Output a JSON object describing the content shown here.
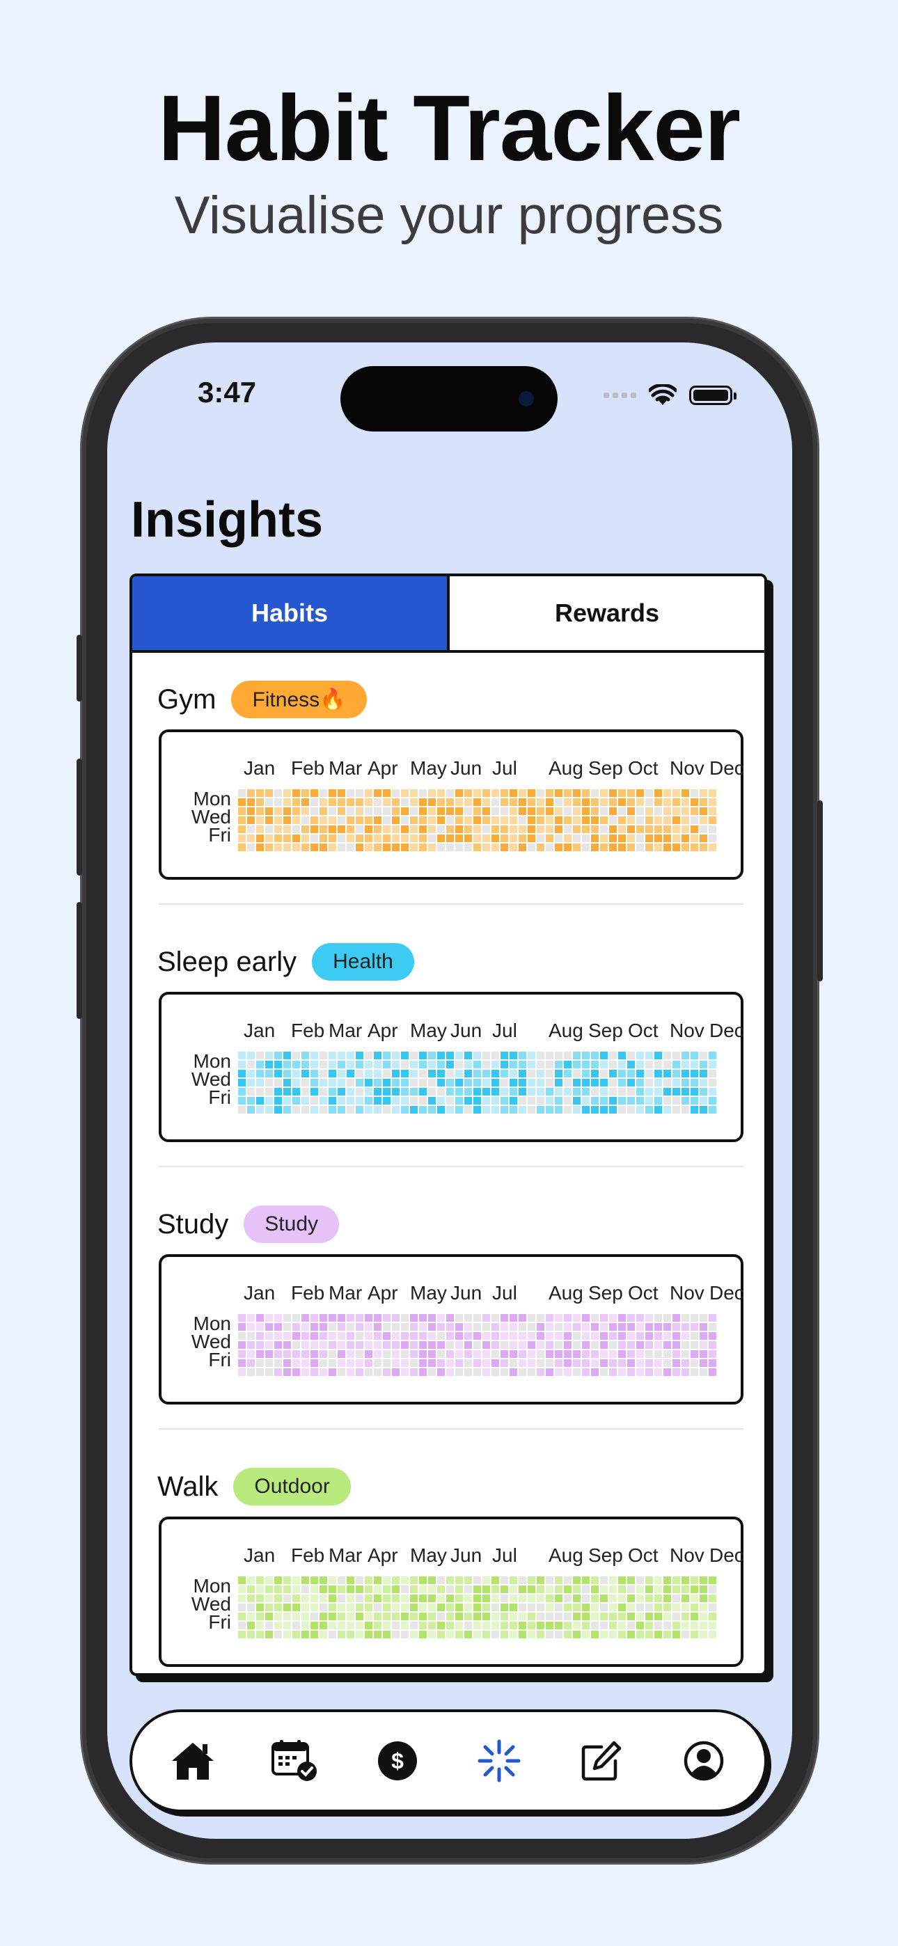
{
  "promo": {
    "title": "Habit Tracker",
    "subtitle": "Visualise your progress"
  },
  "status_bar": {
    "time": "3:47"
  },
  "page_title": "Insights",
  "tabs": [
    {
      "label": "Habits",
      "active": true
    },
    {
      "label": "Rewards",
      "active": false
    }
  ],
  "heatmap_labels": {
    "months": [
      "Jan",
      "Feb",
      "Mar",
      "Apr",
      "May",
      "Jun",
      "Jul",
      "Aug",
      "Sep",
      "Oct",
      "Nov",
      "Dec"
    ],
    "days": [
      "Mon",
      "Wed",
      "Fri"
    ]
  },
  "habits": [
    {
      "name": "Gym",
      "tag": "Fitness🔥",
      "tag_color": "#FFA833",
      "colors": [
        "#E6E6E6",
        "#FCD9A1",
        "#FBC66F",
        "#F9AB3A"
      ]
    },
    {
      "name": "Sleep early",
      "tag": "Health",
      "tag_color": "#3DCBF4",
      "colors": [
        "#E6E6E6",
        "#BFEBFA",
        "#86DDF6",
        "#35C7F2"
      ]
    },
    {
      "name": "Study",
      "tag": "Study",
      "tag_color": "#E7C2F8",
      "colors": [
        "#E6E6E6",
        "#F2DCFA",
        "#E9C7F8",
        "#DDA9F4"
      ]
    },
    {
      "name": "Walk",
      "tag": "Outdoor",
      "tag_color": "#B9EA7E",
      "colors": [
        "#E6E6E6",
        "#E3F6C9",
        "#CDEF9E",
        "#B3E46A"
      ]
    }
  ],
  "bottom_nav": [
    {
      "icon": "home-icon",
      "active": false
    },
    {
      "icon": "calendar-check-icon",
      "active": false
    },
    {
      "icon": "dollar-icon",
      "active": false
    },
    {
      "icon": "insights-sparkle-icon",
      "active": true
    },
    {
      "icon": "edit-icon",
      "active": false
    },
    {
      "icon": "profile-icon",
      "active": false
    }
  ],
  "colors": {
    "accent": "#2457D0",
    "background": "#EDF3FE",
    "screen_bg": "#D8E2FB"
  }
}
